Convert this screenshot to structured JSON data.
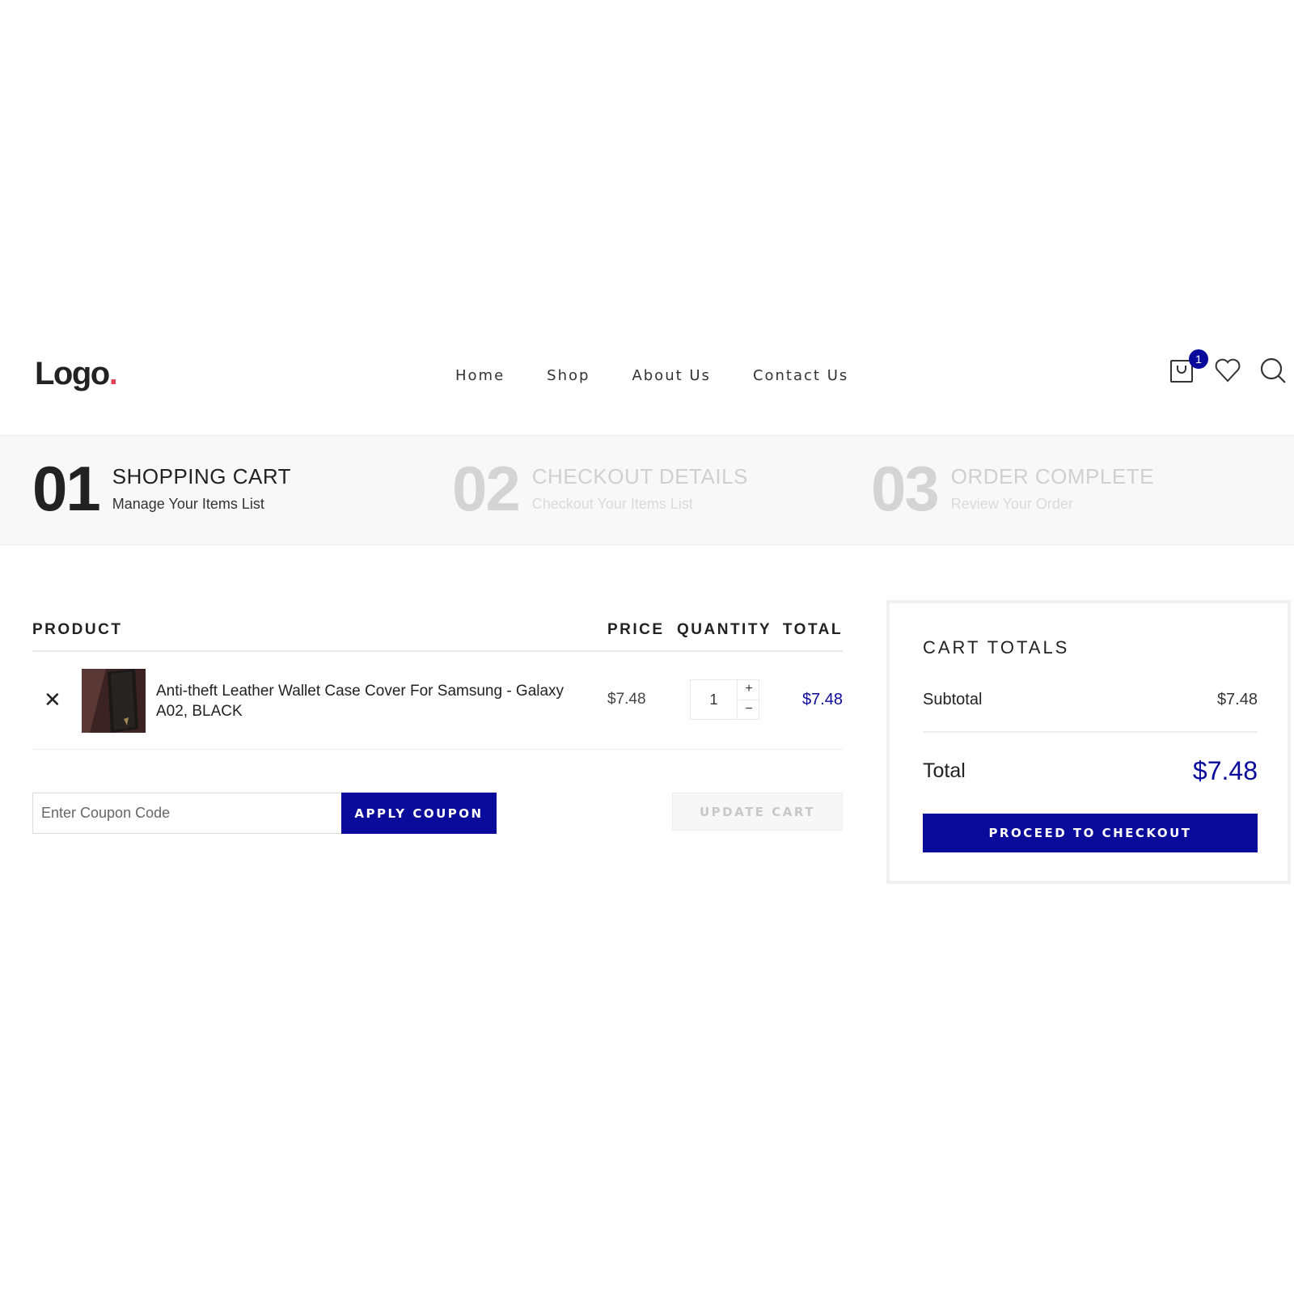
{
  "header": {
    "logo_text": "Logo",
    "logo_dot": ".",
    "nav": [
      "Home",
      "Shop",
      "About Us",
      "Contact Us"
    ],
    "cart_count": "1"
  },
  "steps": [
    {
      "num": "01",
      "title": "SHOPPING CART",
      "subtitle": "Manage Your Items List"
    },
    {
      "num": "02",
      "title": "CHECKOUT DETAILS",
      "subtitle": "Checkout Your Items List"
    },
    {
      "num": "03",
      "title": "ORDER COMPLETE",
      "subtitle": "Review Your Order"
    }
  ],
  "cart": {
    "headers": {
      "product": "PRODUCT",
      "price": "PRICE",
      "quantity": "QUANTITY",
      "total": "TOTAL"
    },
    "items": [
      {
        "remove": "✕",
        "name": "Anti-theft Leather Wallet Case Cover For Samsung - Galaxy A02, BLACK",
        "price": "$7.48",
        "qty": "1",
        "plus": "+",
        "minus": "−",
        "total": "$7.48"
      }
    ],
    "coupon_placeholder": "Enter Coupon Code",
    "apply_label": "APPLY COUPON",
    "update_label": "UPDATE CART"
  },
  "totals": {
    "title": "CART TOTALS",
    "subtotal_label": "Subtotal",
    "subtotal_value": "$7.48",
    "total_label": "Total",
    "total_value": "$7.48",
    "checkout_label": "PROCEED TO CHECKOUT"
  },
  "colors": {
    "accent": "#0a0a9b",
    "logo_dot": "#e0445b"
  },
  "icons": [
    "cart-icon",
    "heart-icon",
    "search-icon",
    "close-icon"
  ]
}
